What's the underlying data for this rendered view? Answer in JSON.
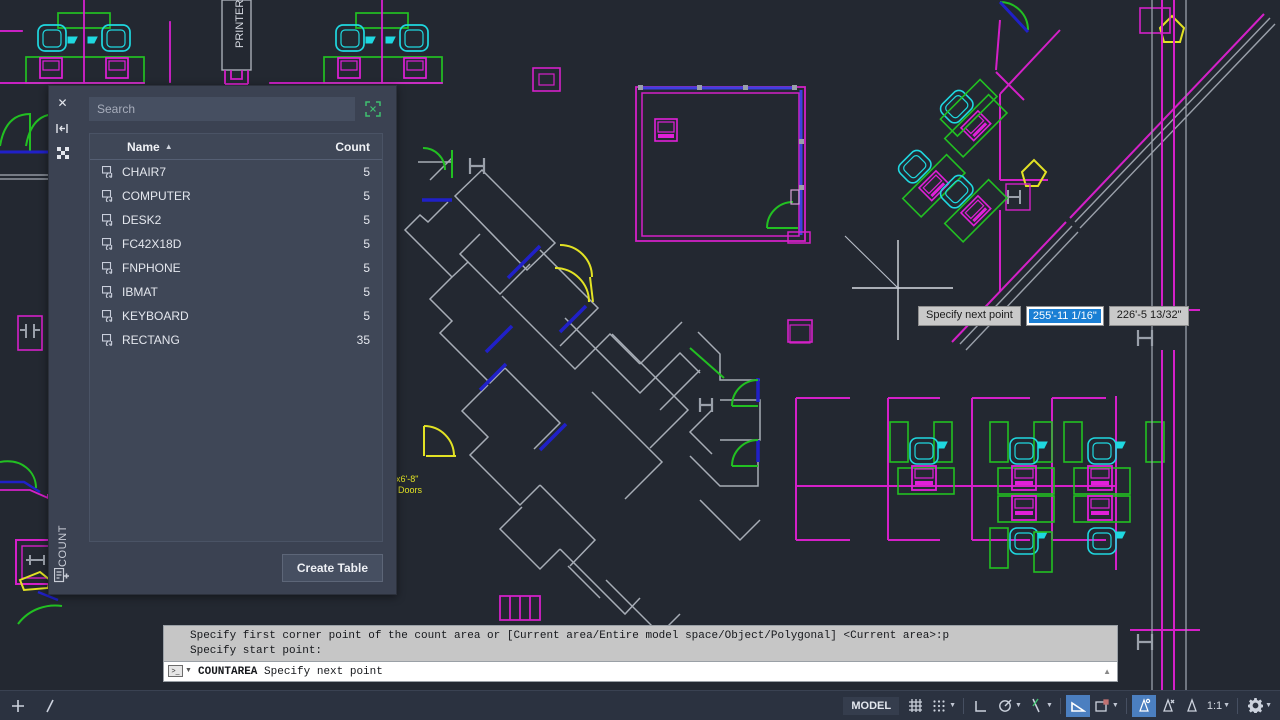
{
  "app": {
    "canvas_background": "#232831"
  },
  "palette": {
    "title": "COUNT",
    "close_icon": "close-icon",
    "autohide_icon": "auto-hide-icon",
    "properties_icon": "properties-icon",
    "bottom_icon": "count-palette-icon",
    "search": {
      "placeholder": "Search",
      "value": ""
    },
    "count_area_icon": "count-area-icon",
    "columns": {
      "name": "Name",
      "count": "Count",
      "sort_indicator": "▲"
    },
    "rows": [
      {
        "icon": "block-icon",
        "name": "CHAIR7",
        "count": "5"
      },
      {
        "icon": "block-icon",
        "name": "COMPUTER",
        "count": "5"
      },
      {
        "icon": "block-icon",
        "name": "DESK2",
        "count": "5"
      },
      {
        "icon": "block-icon",
        "name": "FC42X18D",
        "count": "5"
      },
      {
        "icon": "block-icon",
        "name": "FNPHONE",
        "count": "5"
      },
      {
        "icon": "block-icon",
        "name": "IBMAT",
        "count": "5"
      },
      {
        "icon": "block-icon",
        "name": "KEYBOARD",
        "count": "5"
      },
      {
        "icon": "block-icon",
        "name": "RECTANG",
        "count": "35"
      }
    ],
    "create_table_label": "Create Table"
  },
  "dynamic_input": {
    "prompt": "Specify next point",
    "distance": "255'-11 1/16\"",
    "angle": "226'-5 13/32\"",
    "highlight_color": "#1a7fd4"
  },
  "command_line": {
    "history_line_1": "Specify first corner point of the count area or [Current area/Entire model space/Object/Polygonal] <Current area>:p",
    "history_line_2": "Specify start point:",
    "command_name": "COUNTAREA",
    "command_hint": "Specify next point",
    "prompt_icon": "command-prompt-icon",
    "dropdown_icon": "chevron-down-icon",
    "scroll_icon": "scroll-up-icon",
    "side_icons": [
      "command-history-icon",
      "close-icon",
      "customize-wrench-icon"
    ]
  },
  "status_bar": {
    "model_label": "MODEL",
    "scale_label": "1:1",
    "items": [
      {
        "icon": "grid-display-icon",
        "name": "grid-display",
        "state": "off",
        "caret": false
      },
      {
        "icon": "snap-mode-icon",
        "name": "snap-mode",
        "state": "off",
        "caret": true
      },
      {
        "icon": "ortho-mode-icon",
        "name": "ortho-mode",
        "state": "off",
        "caret": false
      },
      {
        "icon": "polar-tracking-icon",
        "name": "polar-tracking",
        "state": "off",
        "caret": true
      },
      {
        "icon": "object-snap-tracking-icon",
        "name": "object-snap-tracking",
        "state": "off",
        "caret": true
      },
      {
        "icon": "object-snap-icon",
        "name": "object-snap",
        "state": "on",
        "caret": false
      },
      {
        "icon": "lineweight-icon",
        "name": "show-lineweight",
        "state": "off",
        "caret": true
      },
      {
        "icon": "transparency-icon",
        "name": "transparency",
        "state": "on",
        "caret": false
      },
      {
        "icon": "selection-cycling-icon",
        "name": "selection-cycling",
        "state": "off",
        "caret": false
      },
      {
        "icon": "annotation-visibility-icon",
        "name": "annotation-visibility",
        "state": "off",
        "caret": false
      }
    ],
    "settings_icon": "gear-icon",
    "settings_caret_icon": "chevron-down-icon",
    "left_icons": [
      "crosshair-icon",
      "model-space-icon"
    ]
  },
  "drawing": {
    "printer_label": "PRINTER",
    "door_note_size": "x6'-8\"",
    "door_note_text": "Doors",
    "colors": {
      "wall_gray": "#a7adb6",
      "furniture_green": "#22c022",
      "chair_cyan": "#1fd8e0",
      "computer_magenta": "#e020d8",
      "room_magenta": "#d420c8",
      "door_yellow": "#e2e224",
      "door_green": "#22c022",
      "selected_blue": "#3f3fe0",
      "highlight_blue": "#2020c8"
    }
  }
}
